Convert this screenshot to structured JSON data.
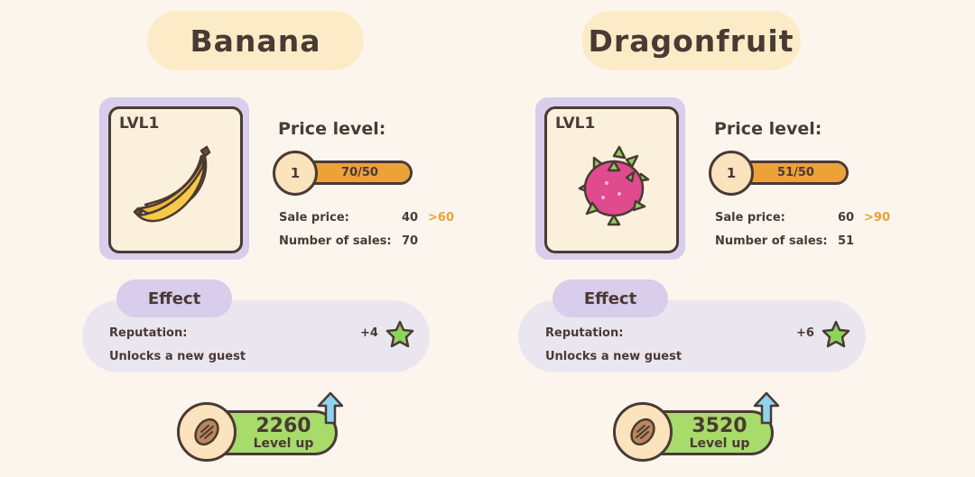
{
  "cards": [
    {
      "name": "Banana",
      "lvl": "LVL1",
      "price_label": "Price level:",
      "price_level": "1",
      "progress_text": "70/50",
      "progress_fraction": 1.0,
      "sale_price_label": "Sale price:",
      "sale_price": "40",
      "sale_price_next": ">60",
      "sales_label": "Number of sales:",
      "sales": "70",
      "effect_label": "Effect",
      "reputation_label": "Reputation:",
      "reputation_value": "+4",
      "unlock_text": "Unlocks a new guest",
      "cost": "2260",
      "levelup_label": "Level up",
      "icon": "banana-icon"
    },
    {
      "name": "Dragonfruit",
      "lvl": "LVL1",
      "price_label": "Price level:",
      "price_level": "1",
      "progress_text": "51/50",
      "progress_fraction": 1.0,
      "sale_price_label": "Sale price:",
      "sale_price": "60",
      "sale_price_next": ">90",
      "sales_label": "Number of sales:",
      "sales": "51",
      "effect_label": "Effect",
      "reputation_label": "Reputation:",
      "reputation_value": "+6",
      "unlock_text": "Unlocks a new guest",
      "cost": "3520",
      "levelup_label": "Level up",
      "icon": "dragonfruit-icon"
    }
  ],
  "colors": {
    "background": "#fcf5ee",
    "title_pill": "#fbecc7",
    "portrait_frame": "#d8cdea",
    "progress_fill": "#eba237",
    "next_price": "#eba237",
    "effect_panel": "#eae6f0",
    "levelup_green": "#a7db6a",
    "star_green": "#8fd45a",
    "arrow_blue": "#8fd3ee"
  }
}
